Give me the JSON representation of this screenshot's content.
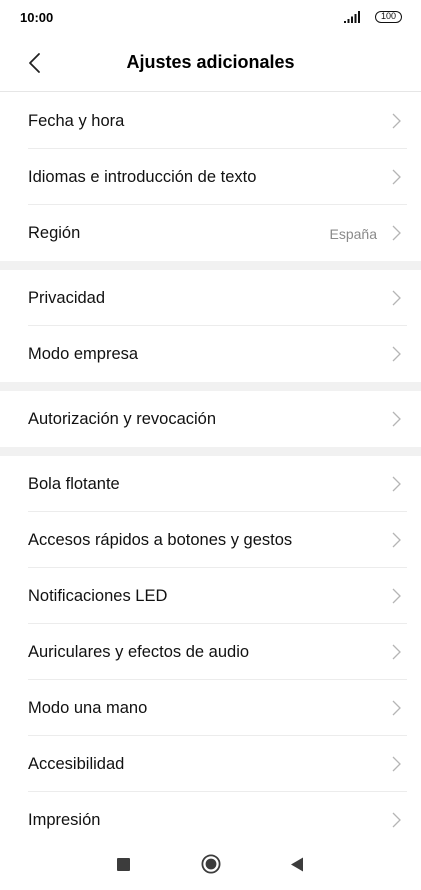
{
  "status": {
    "time": "10:00",
    "battery": "100"
  },
  "header": {
    "title": "Ajustes adicionales"
  },
  "groups": [
    {
      "items": [
        {
          "label": "Fecha y hora"
        },
        {
          "label": "Idiomas e introducción de texto"
        },
        {
          "label": "Región",
          "value": "España"
        }
      ]
    },
    {
      "items": [
        {
          "label": "Privacidad"
        },
        {
          "label": "Modo empresa"
        }
      ]
    },
    {
      "items": [
        {
          "label": "Autorización y revocación"
        }
      ]
    },
    {
      "items": [
        {
          "label": "Bola flotante"
        },
        {
          "label": "Accesos rápidos a botones y gestos"
        },
        {
          "label": "Notificaciones LED"
        },
        {
          "label": "Auriculares y efectos de audio"
        },
        {
          "label": "Modo una mano"
        },
        {
          "label": "Accesibilidad"
        },
        {
          "label": "Impresión"
        }
      ]
    }
  ]
}
